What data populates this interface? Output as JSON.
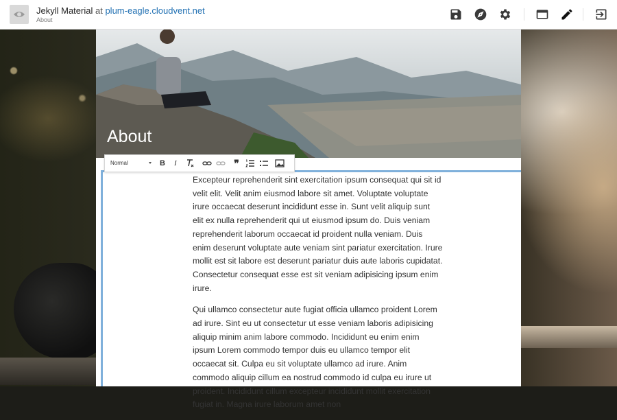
{
  "header": {
    "site_name": "Jekyll Material",
    "at_text": "at",
    "site_domain": "plum-eagle.cloudvent.net",
    "page_name": "About"
  },
  "toolbar": {
    "icons": [
      "save-icon",
      "explore-icon",
      "settings-icon",
      "browser-view-icon",
      "edit-pencil-icon",
      "exit-icon"
    ]
  },
  "page": {
    "title": "About"
  },
  "editor_toolbar": {
    "format_select": "Normal",
    "icons": [
      "bold-icon",
      "italic-icon",
      "clear-format-icon",
      "link-icon",
      "unlink-icon",
      "blockquote-icon",
      "numbered-list-icon",
      "bullet-list-icon",
      "image-icon"
    ]
  },
  "content": {
    "paragraphs": [
      "Excepteur reprehenderit sint exercitation ipsum consequat qui sit id velit elit. Velit anim eiusmod labore sit amet. Voluptate voluptate irure occaecat deserunt incididunt esse in. Sunt velit aliquip sunt elit ex nulla reprehenderit qui ut eiusmod ipsum do. Duis veniam reprehenderit laborum occaecat id proident nulla veniam. Duis enim deserunt voluptate aute veniam sint pariatur exercitation. Irure mollit est sit labore est deserunt pariatur duis aute laboris cupidatat. Consectetur consequat esse est sit veniam adipisicing ipsum enim irure.",
      "Qui ullamco consectetur aute fugiat officia ullamco proident Lorem ad irure. Sint eu ut consectetur ut esse veniam laboris adipisicing aliquip minim anim labore commodo. Incididunt eu enim enim ipsum Lorem commodo tempor duis eu ullamco tempor elit occaecat sit. Culpa eu sit voluptate ullamco ad irure. Anim commodo aliquip cillum ea nostrud commodo id culpa eu irure ut proident. Incididunt cillum excepteur incididunt mollit exercitation fugiat in. Magna irure laborum amet non"
    ]
  },
  "colors": {
    "link": "#1f6fb2",
    "editor_border": "#7fb0db",
    "icon": "#3a3a3a"
  }
}
